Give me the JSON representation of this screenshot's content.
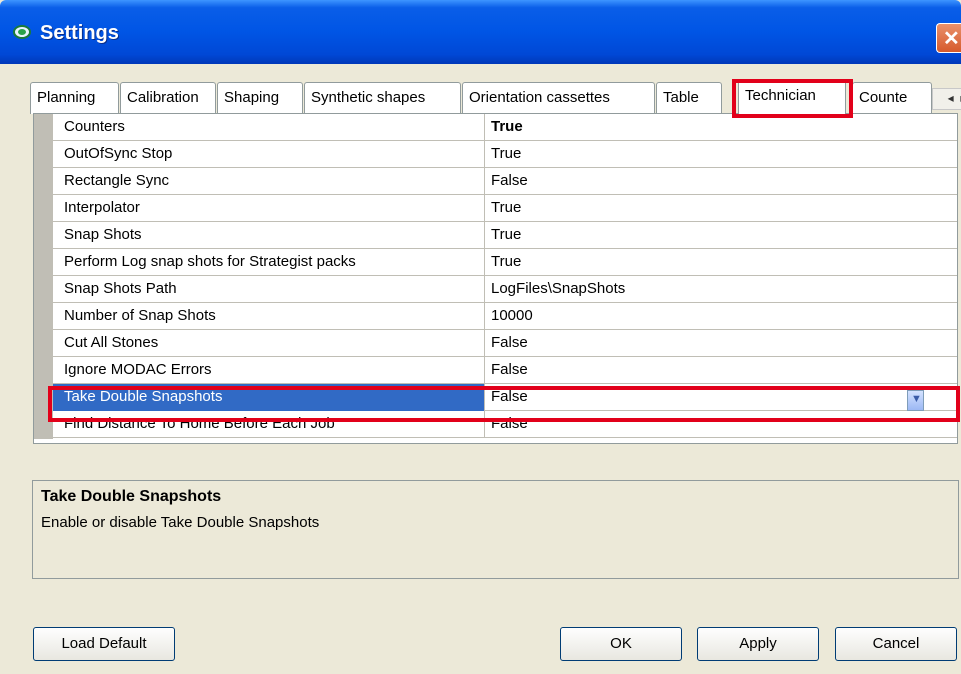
{
  "window": {
    "title": "Settings",
    "close_glyph": "✕"
  },
  "tabs": [
    {
      "label": "Planning",
      "active": false
    },
    {
      "label": "Calibration",
      "active": false
    },
    {
      "label": "Shaping",
      "active": false
    },
    {
      "label": "Synthetic shapes",
      "active": false
    },
    {
      "label": "Orientation cassettes",
      "active": false
    },
    {
      "label": "Table",
      "active": false
    },
    {
      "label": "Technician",
      "active": true
    },
    {
      "label": "Counte",
      "active": false
    }
  ],
  "tab_scroll": {
    "left": "◂",
    "right": "▸"
  },
  "properties": [
    {
      "name": "Counters",
      "value": "True",
      "bold": true
    },
    {
      "name": "OutOfSync Stop",
      "value": "True"
    },
    {
      "name": "Rectangle Sync",
      "value": "False"
    },
    {
      "name": "Interpolator",
      "value": "True"
    },
    {
      "name": "Snap Shots",
      "value": "True"
    },
    {
      "name": "Perform Log snap shots for Strategist packs",
      "value": "True"
    },
    {
      "name": "Snap Shots Path",
      "value": "LogFiles\\SnapShots"
    },
    {
      "name": "Number of Snap Shots",
      "value": "10000"
    },
    {
      "name": "Cut All Stones",
      "value": "False"
    },
    {
      "name": "Ignore MODAC Errors",
      "value": "False"
    },
    {
      "name": "Take Double Snapshots",
      "value": "False",
      "selected": true
    },
    {
      "name": "Find Distance To Home Before Each Job",
      "value": "False"
    }
  ],
  "description": {
    "title": "Take Double Snapshots",
    "text": "Enable or disable Take Double Snapshots"
  },
  "buttons": {
    "load_default": "Load Default",
    "ok": "OK",
    "apply": "Apply",
    "cancel": "Cancel"
  },
  "colors": {
    "titlebar": "#0055e5",
    "selection": "#316ac5",
    "highlight_annotation": "#e2001a"
  }
}
